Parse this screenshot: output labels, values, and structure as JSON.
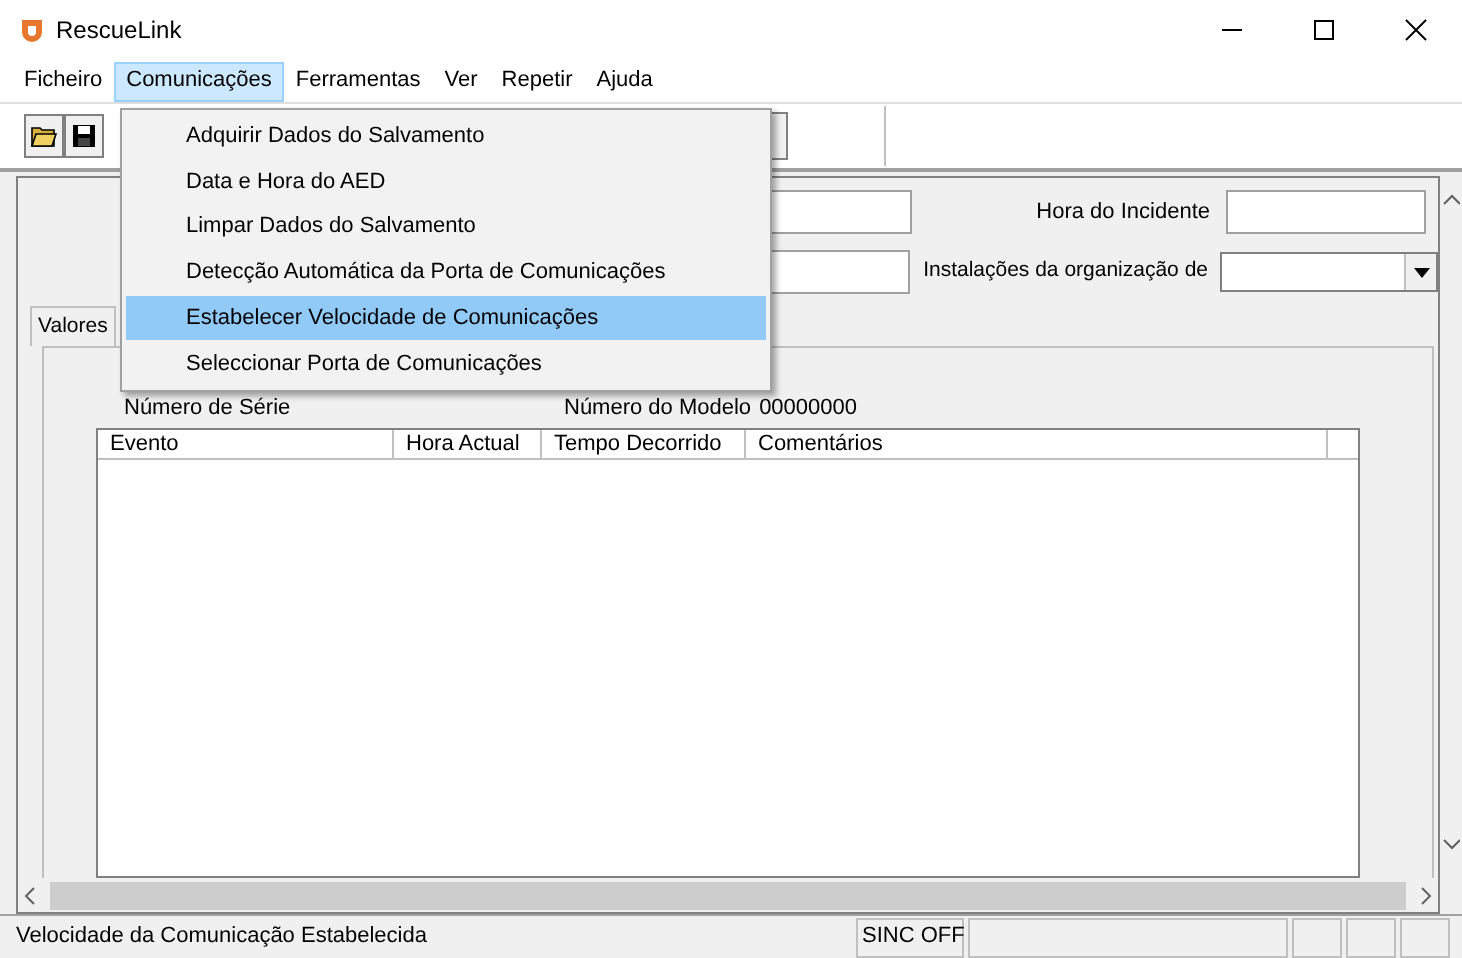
{
  "window": {
    "title": "RescueLink"
  },
  "menu_bar": [
    {
      "label": "Ficheiro",
      "selected": false
    },
    {
      "label": "Comunicações",
      "selected": true
    },
    {
      "label": "Ferramentas",
      "selected": false
    },
    {
      "label": "Ver",
      "selected": false
    },
    {
      "label": "Repetir",
      "selected": false
    },
    {
      "label": "Ajuda",
      "selected": false
    }
  ],
  "dropdown": [
    {
      "label": "Adquirir Dados do Salvamento",
      "selected": false
    },
    {
      "label": "Data e Hora do AED",
      "selected": false
    },
    {
      "label": "Limpar Dados do Salvamento",
      "selected": false
    },
    {
      "label": "Detecção Automática da Porta de Comunicações",
      "selected": false
    },
    {
      "label": "Estabelecer Velocidade de Comunicações",
      "selected": true
    },
    {
      "label": "Seleccionar Porta de Comunicações",
      "selected": false
    }
  ],
  "form": {
    "fields": [
      {
        "label": "Hora do Incidente",
        "kind": "text"
      },
      {
        "label": "Instalações da organização de",
        "kind": "combo"
      }
    ]
  },
  "tabs": [
    {
      "label": "Valores",
      "selected": true
    }
  ],
  "device": {
    "serial_label": "Número de Série",
    "model_label": "Número do Modelo",
    "model_value": "00000000"
  },
  "table": {
    "columns": [
      "Evento",
      "Hora Actual",
      "Tempo Decorrido",
      "Comentários"
    ]
  },
  "status_bar": {
    "message": "Velocidade da Comunicação Estabelecida",
    "sync": "SINC OFF"
  }
}
